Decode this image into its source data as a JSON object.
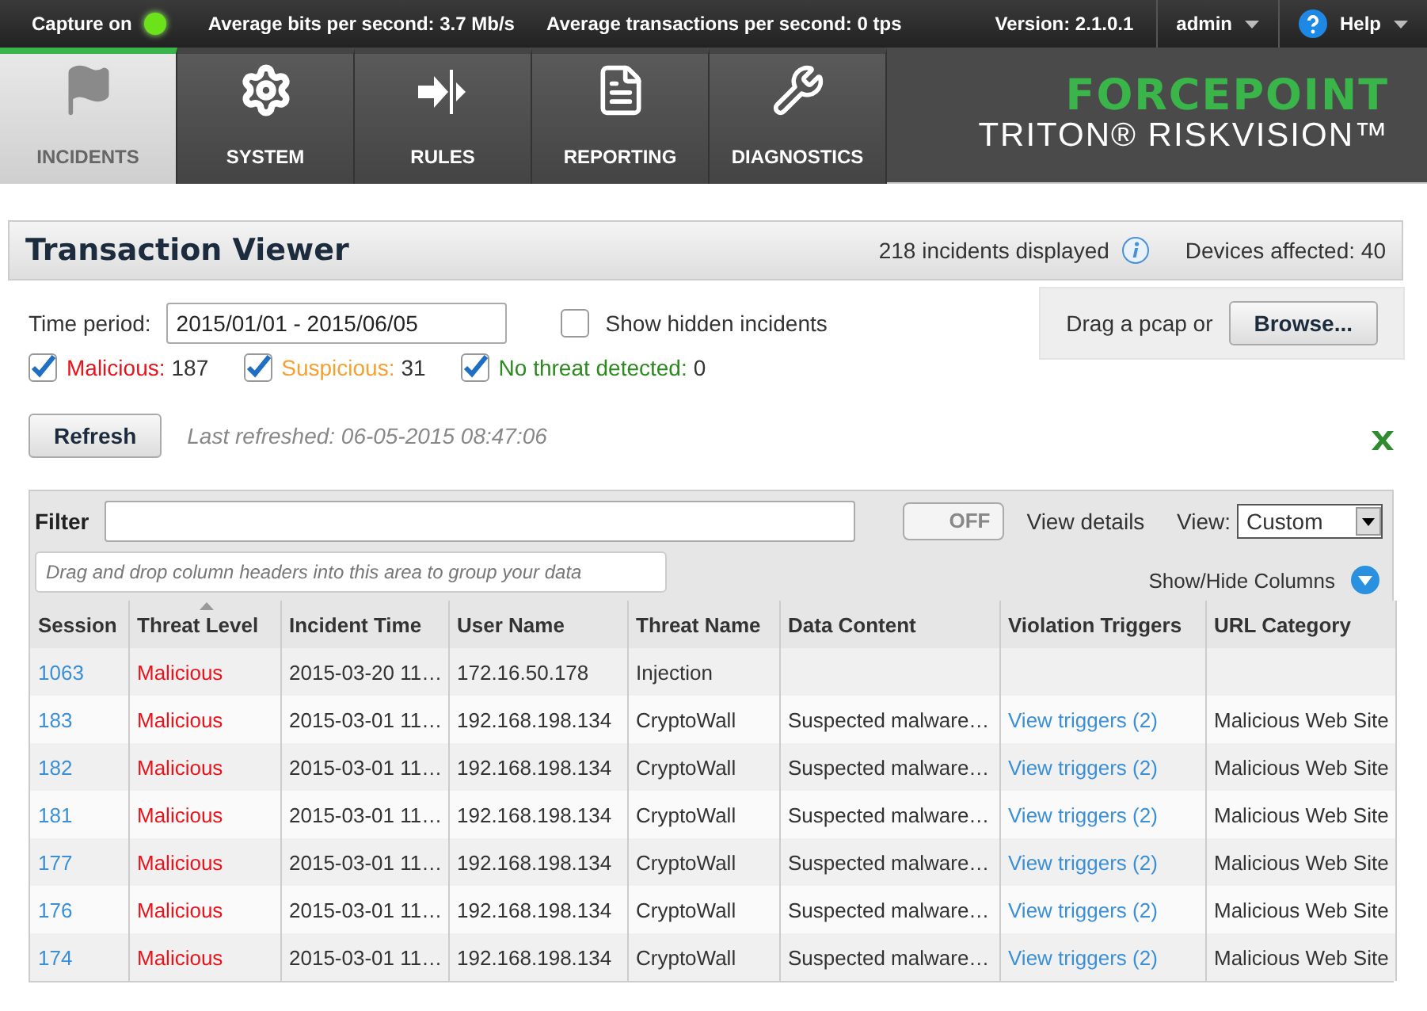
{
  "status_bar": {
    "capture": {
      "label": "Capture on",
      "on": true
    },
    "bits": "Average bits per second: 3.7 Mb/s",
    "transactions": "Average transactions per second: 0 tps",
    "version": "Version: 2.1.0.1",
    "user": "admin",
    "help": "Help"
  },
  "nav": [
    {
      "label": "INCIDENTS",
      "kind": "flag",
      "selected": true
    },
    {
      "label": "SYSTEM",
      "kind": "gear",
      "selected": false
    },
    {
      "label": "RULES",
      "kind": "rules",
      "selected": false
    },
    {
      "label": "REPORTING",
      "kind": "document",
      "selected": false
    },
    {
      "label": "DIAGNOSTICS",
      "kind": "tools",
      "selected": false
    }
  ],
  "logo": {
    "brand": "FORCEPOINT",
    "product": "TRITON® RISKVISION™"
  },
  "header": {
    "title": "Transaction Viewer",
    "incidents": "218 incidents displayed",
    "devices": "Devices affected: 40"
  },
  "controls": {
    "time_label": "Time period:",
    "time_value": "2015/01/01 - 2015/06/05",
    "hidden": {
      "label": "Show hidden incidents",
      "checked": false
    },
    "pcap": "Drag a pcap or",
    "browse": "Browse...",
    "refresh": "Refresh",
    "last_refreshed": "Last refreshed: 06-05-2015 08:47:06"
  },
  "threats": [
    {
      "label": "Malicious:",
      "count": "187",
      "checked": true,
      "color": "#e8141c"
    },
    {
      "label": "Suspicious:",
      "count": "31",
      "checked": true,
      "color": "#f5a030"
    },
    {
      "label": "No threat detected:",
      "count": "0",
      "checked": true,
      "color": "#2a8a1e"
    }
  ],
  "grid": {
    "filter_label": "Filter",
    "toggle": {
      "text": "OFF",
      "on": false
    },
    "view_details": "View details",
    "view_label": "View:",
    "view_value": "Custom",
    "group_placeholder": "Drag and drop column headers into this area to group your data",
    "show_hide": "Show/Hide Columns",
    "columns": [
      {
        "label": "Session",
        "sorted": false
      },
      {
        "label": "Threat Level",
        "sorted": true
      },
      {
        "label": "Incident Time",
        "sorted": false
      },
      {
        "label": "User Name",
        "sorted": false
      },
      {
        "label": "Threat Name",
        "sorted": false
      },
      {
        "label": "Data Content",
        "sorted": false
      },
      {
        "label": "Violation Triggers",
        "sorted": false
      },
      {
        "label": "URL Category",
        "sorted": false
      }
    ],
    "rows": [
      {
        "session": "1063",
        "threat_level": "Malicious",
        "color": "#e8141c",
        "incident_time": "2015-03-20 11…",
        "user_name": "172.16.50.178",
        "threat_name": "Injection"
      },
      {
        "session": "183",
        "threat_level": "Malicious",
        "color": "#e8141c",
        "incident_time": "2015-03-01 11…",
        "user_name": "192.168.198.134",
        "threat_name": "CryptoWall",
        "data_content": "Suspected malware…",
        "violation_triggers": "View triggers (2)",
        "url_category": "Malicious Web Site"
      },
      {
        "session": "182",
        "threat_level": "Malicious",
        "color": "#e8141c",
        "incident_time": "2015-03-01 11…",
        "user_name": "192.168.198.134",
        "threat_name": "CryptoWall",
        "data_content": "Suspected malware…",
        "violation_triggers": "View triggers (2)",
        "url_category": "Malicious Web Site"
      },
      {
        "session": "181",
        "threat_level": "Malicious",
        "color": "#e8141c",
        "incident_time": "2015-03-01 11…",
        "user_name": "192.168.198.134",
        "threat_name": "CryptoWall",
        "data_content": "Suspected malware…",
        "violation_triggers": "View triggers (2)",
        "url_category": "Malicious Web Site"
      },
      {
        "session": "177",
        "threat_level": "Malicious",
        "color": "#e8141c",
        "incident_time": "2015-03-01 11…",
        "user_name": "192.168.198.134",
        "threat_name": "CryptoWall",
        "data_content": "Suspected malware…",
        "violation_triggers": "View triggers (2)",
        "url_category": "Malicious Web Site"
      },
      {
        "session": "176",
        "threat_level": "Malicious",
        "color": "#e8141c",
        "incident_time": "2015-03-01 11…",
        "user_name": "192.168.198.134",
        "threat_name": "CryptoWall",
        "data_content": "Suspected malware…",
        "violation_triggers": "View triggers (2)",
        "url_category": "Malicious Web Site"
      },
      {
        "session": "174",
        "threat_level": "Malicious",
        "color": "#e8141c",
        "incident_time": "2015-03-01 11…",
        "user_name": "192.168.198.134",
        "threat_name": "CryptoWall",
        "data_content": "Suspected malware…",
        "violation_triggers": "View triggers (2)",
        "url_category": "Malicious Web Site"
      }
    ]
  }
}
